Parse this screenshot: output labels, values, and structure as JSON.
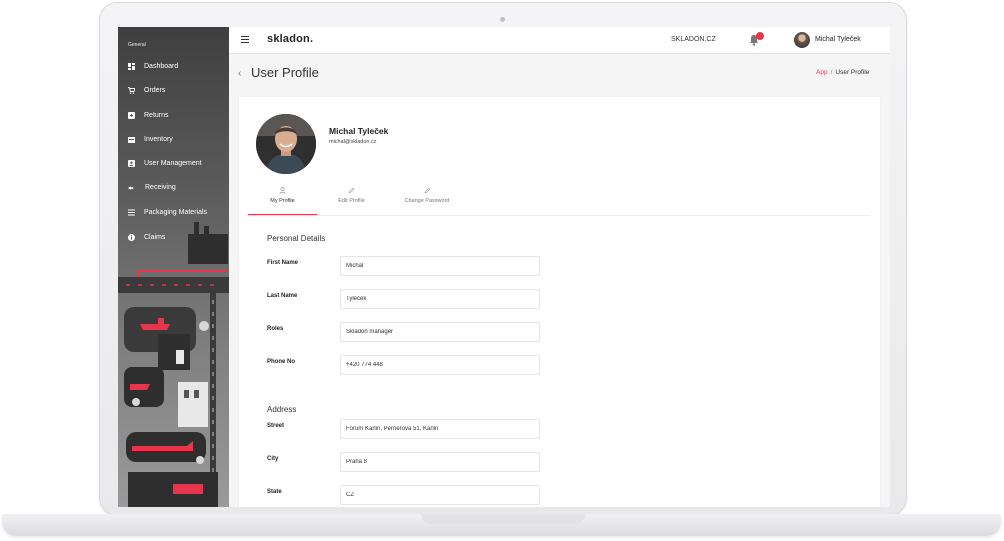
{
  "sidebar": {
    "section_label": "General",
    "items": [
      {
        "label": "Dashboard",
        "icon": "dashboard-icon"
      },
      {
        "label": "Orders",
        "icon": "cart-icon"
      },
      {
        "label": "Returns",
        "icon": "returns-icon"
      },
      {
        "label": "Inventory",
        "icon": "inventory-icon"
      },
      {
        "label": "User Management",
        "icon": "user-card-icon"
      },
      {
        "label": "Receiving",
        "icon": "receiving-icon"
      },
      {
        "label": "Packaging Materials",
        "icon": "list-icon"
      },
      {
        "label": "Claims",
        "icon": "info-icon"
      }
    ]
  },
  "header": {
    "brand": "skladon.",
    "site_link": "SKLADON.CZ",
    "notification_count": "",
    "user_name": "Michal Tyleček"
  },
  "page": {
    "title": "User Profile",
    "breadcrumb": {
      "root": "App",
      "separator": "/",
      "current": "User Profile"
    }
  },
  "profile": {
    "name": "Michal Tyleček",
    "email": "michal@skladon.cz",
    "tabs": [
      {
        "label": "My Profile",
        "icon": "user-icon",
        "active": true
      },
      {
        "label": "Edit Profile",
        "icon": "pencil-icon",
        "active": false
      },
      {
        "label": "Change Password",
        "icon": "pencil-icon",
        "active": false
      }
    ]
  },
  "personal_details": {
    "title": "Personal Details",
    "fields": [
      {
        "label": "First Name",
        "value": "Michal"
      },
      {
        "label": "Last Name",
        "value": "Tyleček"
      },
      {
        "label": "Roles",
        "value": "Skladon manager"
      },
      {
        "label": "Phone No",
        "value": "+420 774 448"
      }
    ]
  },
  "address": {
    "title": "Address",
    "fields": [
      {
        "label": "Street",
        "value": "Forum Karlin, Pernerova 51, Karlin"
      },
      {
        "label": "City",
        "value": "Praha 8"
      },
      {
        "label": "State",
        "value": "CZ"
      }
    ]
  },
  "colors": {
    "accent": "#e8354e",
    "sidebar_dark": "#3f3f3f",
    "page_background": "#f5f5f5"
  }
}
